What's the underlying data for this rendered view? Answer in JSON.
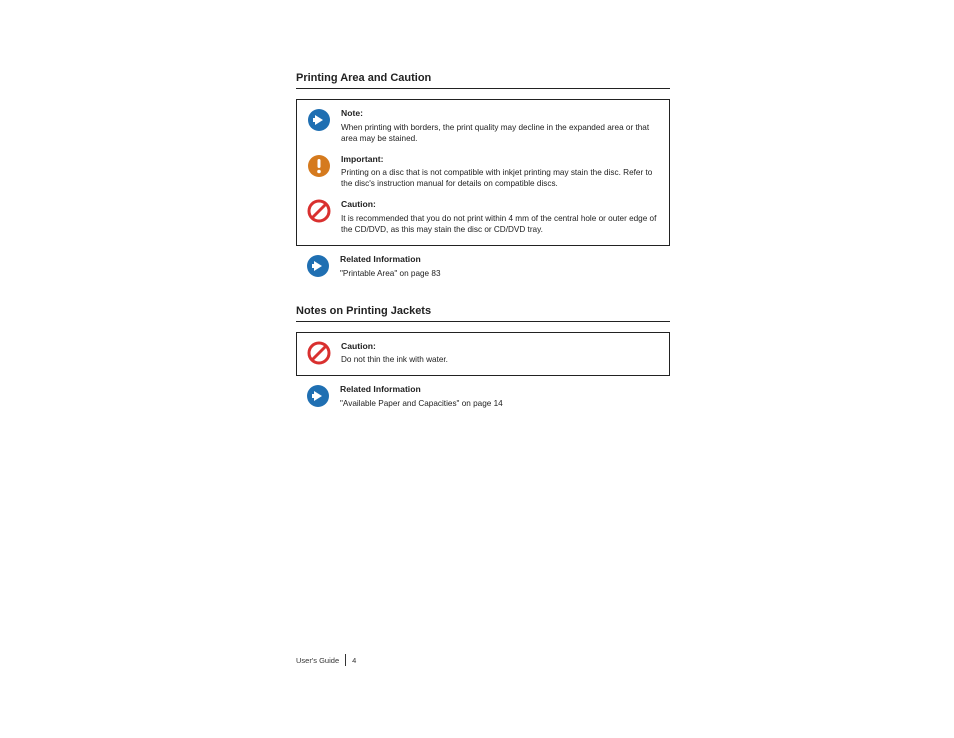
{
  "sections": {
    "a": {
      "title": "Printing Area and Caution",
      "note": {
        "head": "Note:",
        "text": "When printing with borders, the print quality may decline in the expanded area or that area may be stained."
      },
      "important": {
        "head": "Important:",
        "text": "Printing on a disc that is not compatible with inkjet printing may stain the disc. Refer to the disc's instruction manual for details on compatible discs."
      },
      "caution": {
        "head": "Caution:",
        "text": "It is recommended that you do not print within 4 mm of the central hole or outer edge of the CD/DVD, as this may stain the disc or CD/DVD tray."
      },
      "related": {
        "head": "Related Information",
        "items": "\"Printable Area\" on page 83"
      }
    },
    "b": {
      "title": "Notes on Printing Jackets",
      "caution": {
        "head": "Caution:",
        "text": "Do not thin the ink with water."
      },
      "related": {
        "head": "Related Information",
        "items": "\"Available Paper and Capacities\" on page 14"
      }
    }
  },
  "footer": {
    "left": "User's Guide",
    "right": "4"
  },
  "colors": {
    "blue": "#1f6fb2",
    "orange": "#d57a1e",
    "red": "#d9302f"
  }
}
